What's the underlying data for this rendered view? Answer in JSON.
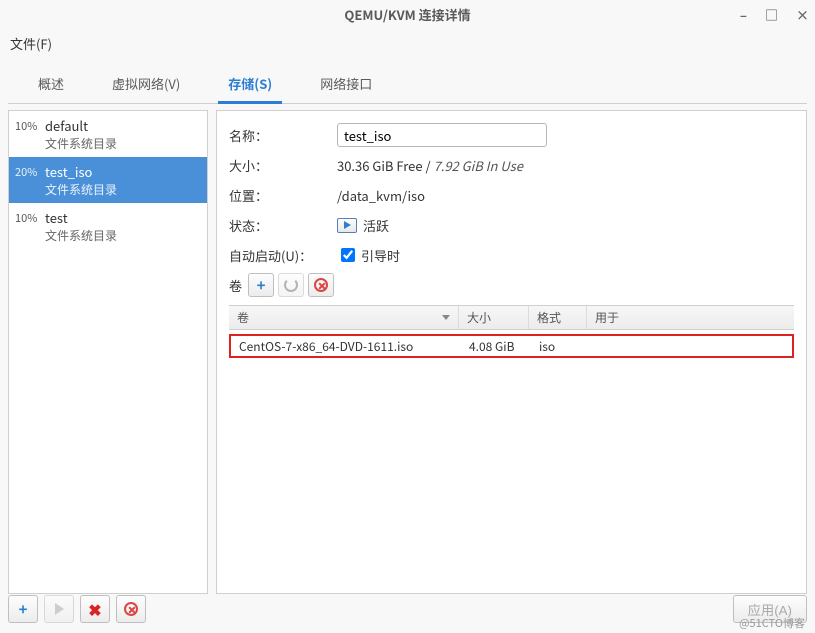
{
  "window": {
    "title": "QEMU/KVM 连接详情",
    "minimize": "–",
    "maximize": "□",
    "close": "×"
  },
  "menubar": {
    "file": "文件(F)"
  },
  "tabs": {
    "overview": "概述",
    "vnet": "虚拟网络(V)",
    "storage": "存储(S)",
    "niface": "网络接口"
  },
  "pools": [
    {
      "pct": "10%",
      "name": "default",
      "sub": "文件系统目录"
    },
    {
      "pct": "20%",
      "name": "test_iso",
      "sub": "文件系统目录"
    },
    {
      "pct": "10%",
      "name": "test",
      "sub": "文件系统目录"
    }
  ],
  "fields": {
    "name_label": "名称：",
    "name_value": "test_iso",
    "size_label": "大小：",
    "size_free": "30.36 GiB Free / ",
    "size_used": "7.92 GiB In Use",
    "loc_label": "位置：",
    "loc_value": "/data_kvm/iso",
    "state_label": "状态：",
    "state_value": "活跃",
    "auto_label": "自动启动(U)：",
    "auto_value": "引导时",
    "vol_label": "卷"
  },
  "vol_headers": {
    "c1": "卷",
    "c2": "大小",
    "c3": "格式",
    "c4": "用于"
  },
  "volumes": [
    {
      "name": "CentOS-7-x86_64-DVD-1611.iso",
      "size": "4.08 GiB",
      "format": "iso",
      "used": ""
    }
  ],
  "bottom": {
    "apply": "应用(A)"
  },
  "watermark": "@51CTO博客"
}
